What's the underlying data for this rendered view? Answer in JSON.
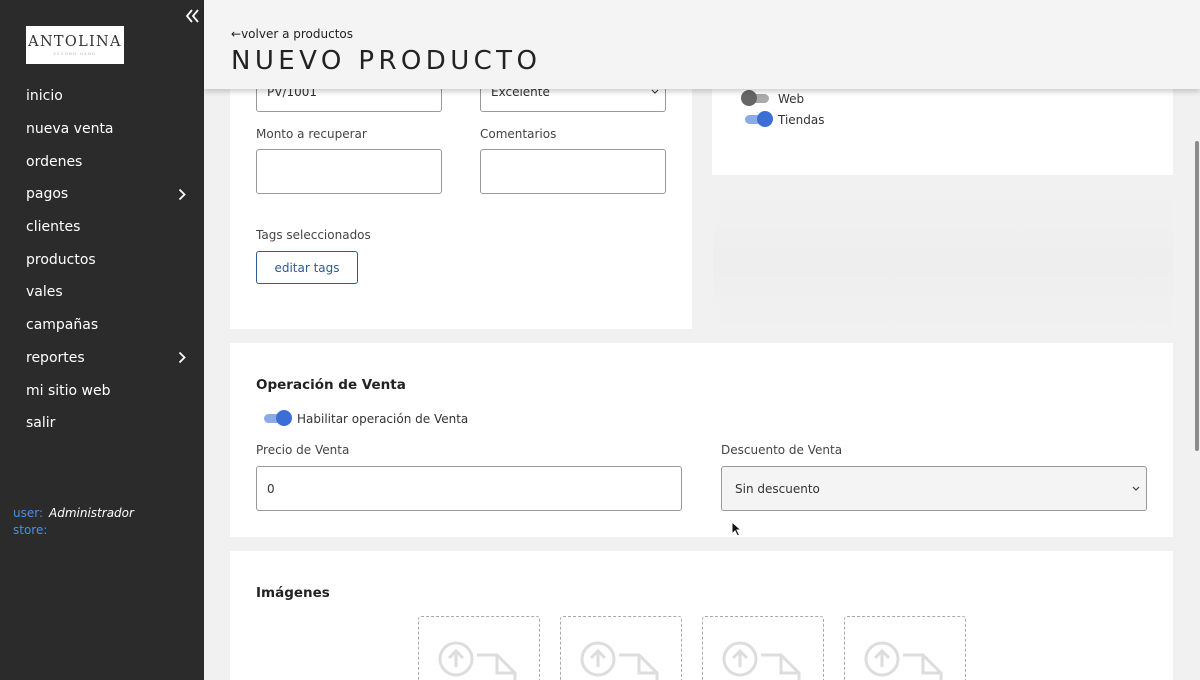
{
  "sidebar": {
    "logo": {
      "text": "ANTOLINA",
      "sub": "SECOND HAND"
    },
    "items": [
      {
        "label": "inicio",
        "has_chevron": false
      },
      {
        "label": "nueva venta",
        "has_chevron": false
      },
      {
        "label": "ordenes",
        "has_chevron": false
      },
      {
        "label": "pagos",
        "has_chevron": true
      },
      {
        "label": "clientes",
        "has_chevron": false
      },
      {
        "label": "productos",
        "has_chevron": false
      },
      {
        "label": "vales",
        "has_chevron": false
      },
      {
        "label": "campañas",
        "has_chevron": false
      },
      {
        "label": "reportes",
        "has_chevron": true
      },
      {
        "label": "mi sitio web",
        "has_chevron": false
      },
      {
        "label": "salir",
        "has_chevron": false
      }
    ],
    "user_label": "user:",
    "user_value": "Administrador",
    "store_label": "store:",
    "store_value": "",
    "collapse_icon": "double-chevron-left-icon"
  },
  "header": {
    "back_link": "volver a productos",
    "title": "NUEVO PRODUCTO"
  },
  "top_card": {
    "field_code_value": "PV/1001",
    "field_condition_value": "Excelente",
    "monto_label": "Monto a recuperar",
    "monto_value": "",
    "comentarios_label": "Comentarios",
    "comentarios_value": "",
    "tags_label": "Tags seleccionados",
    "edit_tags_button": "editar tags"
  },
  "channels_card": {
    "web_label": "Web",
    "web_enabled": false,
    "tiendas_label": "Tiendas",
    "tiendas_enabled": true
  },
  "sale_card": {
    "title": "Operación de Venta",
    "toggle_label": "Habilitar operación de Venta",
    "toggle_enabled": true,
    "price_label": "Precio de Venta",
    "price_value": "0",
    "discount_label": "Descuento de Venta",
    "discount_value": "Sin descuento"
  },
  "images_card": {
    "title": "Imágenes",
    "slot_icon": "upload-file-icon"
  },
  "colors": {
    "sidebar_bg": "#2b2b2b",
    "accent_blue": "#3b6fd6",
    "button_border": "#2f5a92",
    "user_key": "#4d8fe0"
  }
}
